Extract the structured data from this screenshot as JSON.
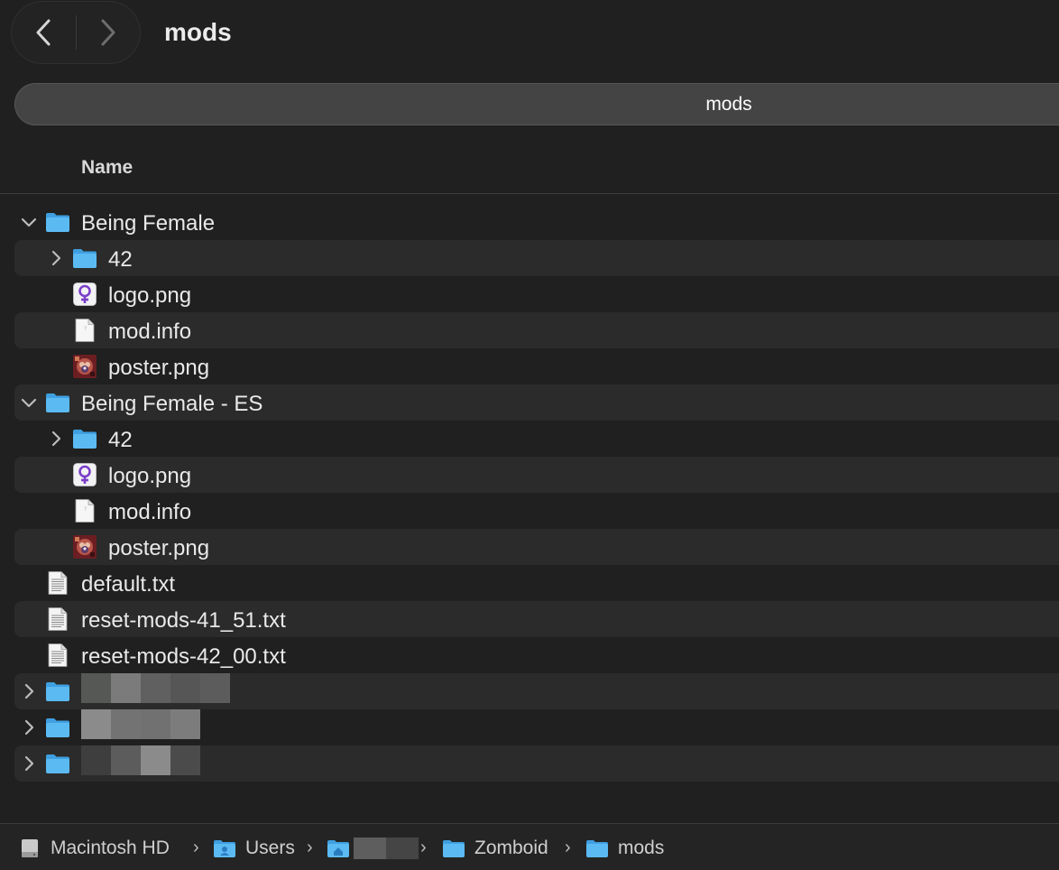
{
  "window": {
    "title": "mods"
  },
  "tabbar": {
    "active_tab": "mods"
  },
  "columns": {
    "name": "Name"
  },
  "rows": [
    {
      "label": "Being Female",
      "kind": "folder",
      "expanded": true
    },
    {
      "label": "42",
      "kind": "folder",
      "expanded": false
    },
    {
      "label": "logo.png",
      "kind": "female-symbol-image"
    },
    {
      "label": "mod.info",
      "kind": "blank-file"
    },
    {
      "label": "poster.png",
      "kind": "poster-image"
    },
    {
      "label": "Being Female - ES",
      "kind": "folder",
      "expanded": true
    },
    {
      "label": "42",
      "kind": "folder",
      "expanded": false
    },
    {
      "label": "logo.png",
      "kind": "female-symbol-image"
    },
    {
      "label": "mod.info",
      "kind": "blank-file"
    },
    {
      "label": "poster.png",
      "kind": "poster-image"
    },
    {
      "label": "default.txt",
      "kind": "text-file"
    },
    {
      "label": "reset-mods-41_51.txt",
      "kind": "text-file"
    },
    {
      "label": "reset-mods-42_00.txt",
      "kind": "text-file"
    }
  ],
  "breadcrumbs": [
    {
      "label": "Macintosh HD",
      "icon": "hard-drive-icon"
    },
    {
      "label": "Users",
      "icon": "users-folder-icon"
    },
    {
      "label": "",
      "icon": "home-folder-icon"
    },
    {
      "label": "Zomboid",
      "icon": "folder-icon"
    },
    {
      "label": "mods",
      "icon": "folder-icon"
    }
  ],
  "colors": {
    "folder": "#5ab8f2",
    "folder_dark": "#3c9ee0",
    "accent_purple": "#7b3fc9"
  }
}
